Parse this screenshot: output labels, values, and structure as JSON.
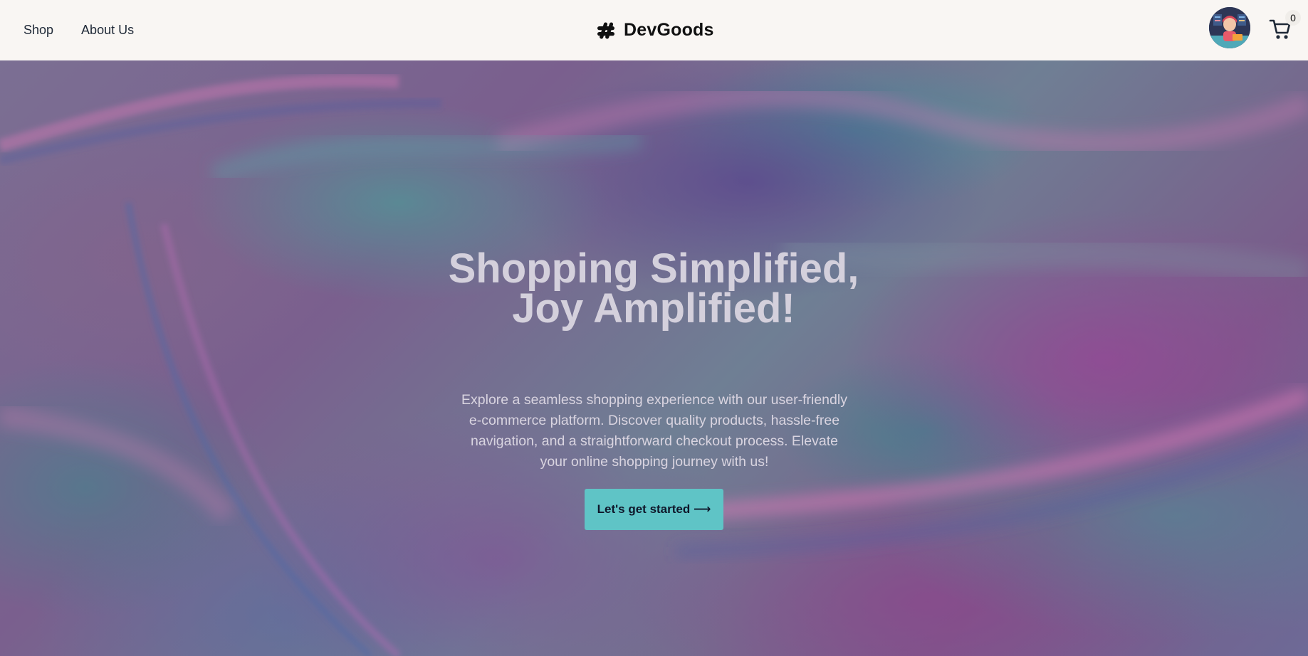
{
  "nav": {
    "links": [
      "Shop",
      "About Us"
    ]
  },
  "brand": {
    "name": "DevGoods",
    "icon": "hashtag-icon"
  },
  "header": {
    "avatar_icon": "user-avatar",
    "cart_icon": "cart-icon",
    "cart_count": "0"
  },
  "hero": {
    "title": "Shopping Simplified, Joy Amplified!",
    "description": "Explore a seamless shopping experience with our user-friendly e-commerce platform. Discover quality products, hassle-free navigation, and a straightforward checkout process. Elevate your online shopping journey with us!",
    "cta_label": "Let's get started ⟶"
  },
  "colors": {
    "nav_bg": "#f9f6f3",
    "cta_bg": "#5fc4c6",
    "hero_text": "#d4d0dc"
  }
}
